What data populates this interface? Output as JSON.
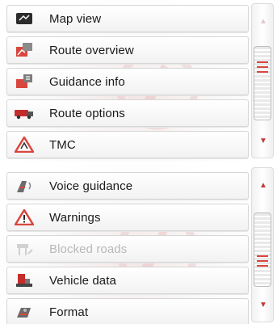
{
  "menu_top": {
    "items": [
      {
        "label": "Map view",
        "icon": "map-view-icon",
        "enabled": true
      },
      {
        "label": "Route overview",
        "icon": "route-overview-icon",
        "enabled": true
      },
      {
        "label": "Guidance info",
        "icon": "guidance-info-icon",
        "enabled": true
      },
      {
        "label": "Route options",
        "icon": "route-options-icon",
        "enabled": true
      },
      {
        "label": "TMC",
        "icon": "tmc-warning-icon",
        "enabled": true
      }
    ],
    "scroll": {
      "up_arrow": "▲",
      "down_arrow": "▼",
      "up_enabled": false,
      "down_enabled": true,
      "position": 0.0
    }
  },
  "menu_bottom": {
    "items": [
      {
        "label": "Voice guidance",
        "icon": "voice-guidance-icon",
        "enabled": true
      },
      {
        "label": "Warnings",
        "icon": "warning-triangle-icon",
        "enabled": true
      },
      {
        "label": "Blocked roads",
        "icon": "blocked-roads-icon",
        "enabled": false
      },
      {
        "label": "Vehicle data",
        "icon": "vehicle-data-icon",
        "enabled": true
      },
      {
        "label": "Format",
        "icon": "format-icon",
        "enabled": true
      }
    ],
    "scroll": {
      "up_arrow": "▲",
      "down_arrow": "▼",
      "up_enabled": true,
      "down_enabled": true,
      "position": 1.0
    }
  },
  "colors": {
    "accent_red": "#d9463d",
    "text": "#1a1a1a",
    "disabled_text": "#b9b9b9"
  }
}
